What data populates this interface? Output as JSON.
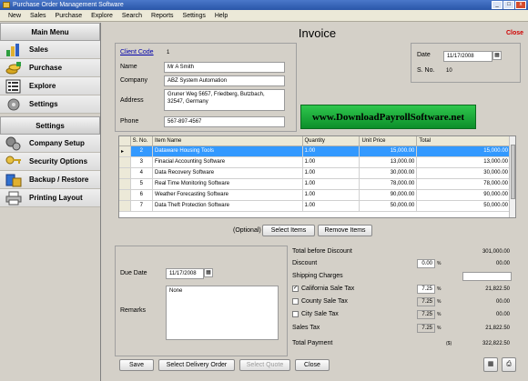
{
  "window": {
    "title": "Purchase Order Management Software"
  },
  "menubar": [
    "New",
    "Sales",
    "Purchase",
    "Explore",
    "Search",
    "Reports",
    "Settings",
    "Help"
  ],
  "sidebar": {
    "main_menu_title": "Main Menu",
    "main_items": [
      {
        "label": "Sales",
        "icon": "chart-icon"
      },
      {
        "label": "Purchase",
        "icon": "coins-icon"
      },
      {
        "label": "Explore",
        "icon": "list-icon"
      },
      {
        "label": "Settings",
        "icon": "gear-icon"
      }
    ],
    "settings_title": "Settings",
    "settings_items": [
      {
        "label": "Company Setup",
        "icon": "gears-icon"
      },
      {
        "label": "Security Options",
        "icon": "keys-icon"
      },
      {
        "label": "Backup / Restore",
        "icon": "database-icon"
      },
      {
        "label": "Printing Layout",
        "icon": "printer-icon"
      }
    ]
  },
  "invoice": {
    "title": "Invoice",
    "close_label": "Close",
    "client_code_label": "Client Code",
    "client_code": "1",
    "name_label": "Name",
    "name": "Mr A Smith",
    "company_label": "Company",
    "company": "ABZ System Automation",
    "address_label": "Address",
    "address": "Gruner Weg 5657, Friedberg, Butzbach, 32547, Germany",
    "phone_label": "Phone",
    "phone": "567-897-4567",
    "date_label": "Date",
    "date": "11/17/2008",
    "sno_label": "S. No.",
    "sno": "10",
    "banner_text": "www.DownloadPayrollSoftware.net"
  },
  "grid": {
    "columns": [
      "S. No.",
      "Item Name",
      "Quantity",
      "Unit Price",
      "Total"
    ],
    "rows": [
      [
        "2",
        "Dataware Housing Tools",
        "1.00",
        "15,000.00",
        "15,000.00"
      ],
      [
        "3",
        "Finacial Accounting Software",
        "1.00",
        "13,000.00",
        "13,000.00"
      ],
      [
        "4",
        "Data Recovery Software",
        "1.00",
        "30,000.00",
        "30,000.00"
      ],
      [
        "5",
        "Real Time Monitoring Software",
        "1.00",
        "78,000.00",
        "78,000.00"
      ],
      [
        "6",
        "Weather Forecasting Software",
        "1.00",
        "90,000.00",
        "90,000.00"
      ],
      [
        "7",
        "Data Theft Protection Software",
        "1.00",
        "50,000.00",
        "50,000.00"
      ]
    ],
    "optional_label": "(Optional)",
    "select_items_label": "Select Items",
    "remove_items_label": "Remove Items"
  },
  "details": {
    "due_date_label": "Due Date",
    "due_date": "11/17/2008",
    "remarks_label": "Remarks",
    "remarks": "None"
  },
  "summary": {
    "total_before_discount_label": "Total before Discount",
    "total_before_discount": "301,000.00",
    "discount_label": "Discount",
    "discount_pct": "0.00",
    "discount_amt": "00.00",
    "shipping_label": "Shipping Charges",
    "shipping_amt": "",
    "tax_rows": [
      {
        "label": "California Sale Tax",
        "checked": true,
        "pct": "7.25",
        "amt": "21,822.50"
      },
      {
        "label": "County Sale Tax",
        "checked": false,
        "pct": "7.25",
        "amt": "00.00"
      },
      {
        "label": "City Sale Tax",
        "checked": false,
        "pct": "7.25",
        "amt": "00.00"
      }
    ],
    "percent_sign": "%",
    "sales_tax_label": "Sales Tax",
    "sales_tax_pct": "7.25",
    "sales_tax_amt": "21,822.50",
    "total_payment_label": "Total Payment",
    "currency_sign": "($)",
    "total_payment": "322,822.50"
  },
  "footer": {
    "save_label": "Save",
    "select_delivery_order_label": "Select Delivery Order",
    "select_quote_label": "Select Quote",
    "close_label": "Close"
  }
}
